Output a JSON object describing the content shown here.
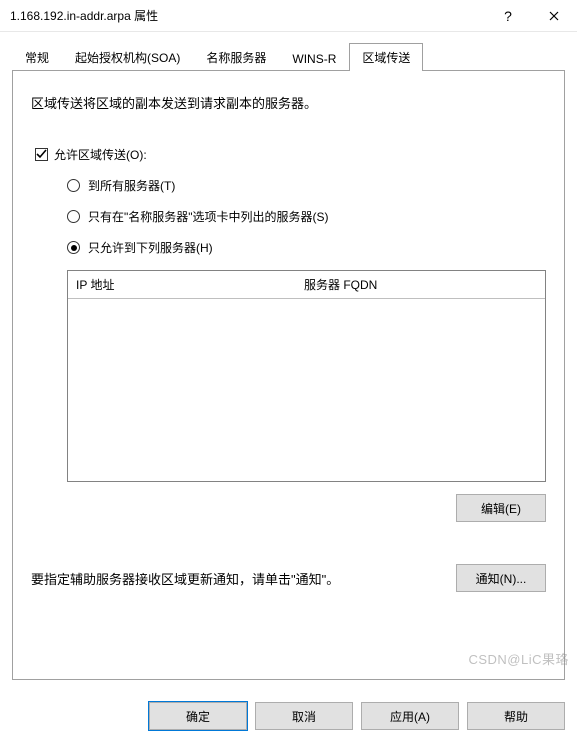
{
  "titlebar": {
    "title": "1.168.192.in-addr.arpa 属性"
  },
  "tabs": {
    "general": "常规",
    "soa": "起始授权机构(SOA)",
    "ns": "名称服务器",
    "wins": "WINS-R",
    "zone_transfer": "区域传送"
  },
  "panel": {
    "desc": "区域传送将区域的副本发送到请求副本的服务器。",
    "allow_transfer_label": "允许区域传送(O):",
    "radio_all": "到所有服务器(T)",
    "radio_ns_tab": "只有在\"名称服务器\"选项卡中列出的服务器(S)",
    "radio_only_below": "只允许到下列服务器(H)",
    "col_ip": "IP 地址",
    "col_fqdn": "服务器 FQDN",
    "edit_btn": "编辑(E)",
    "notify_text": "要指定辅助服务器接收区域更新通知，请单击\"通知\"。",
    "notify_btn": "通知(N)..."
  },
  "footer": {
    "ok": "确定",
    "cancel": "取消",
    "apply": "应用(A)",
    "help": "帮助"
  },
  "watermark": "CSDN@LiC果珞"
}
